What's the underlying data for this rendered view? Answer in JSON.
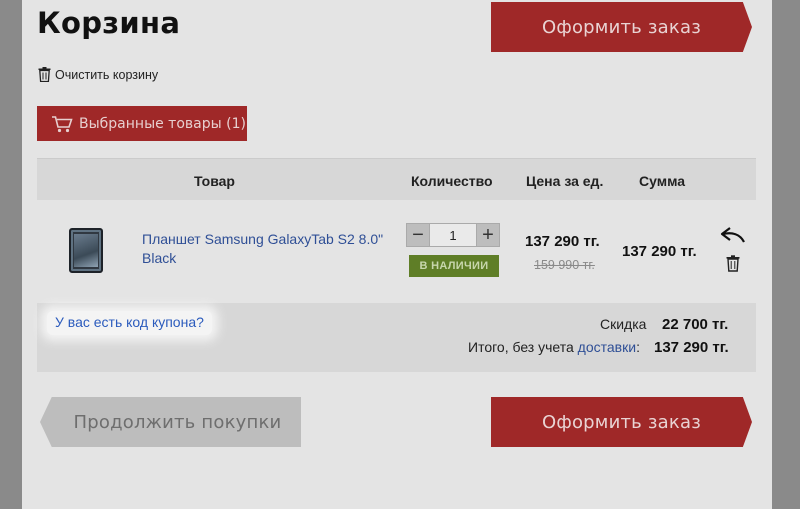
{
  "header": {
    "title": "Корзина",
    "checkout_label": "Оформить заказ",
    "clear_cart_label": "Очистить корзину"
  },
  "favorites": {
    "label": "Выбранные товары (1)"
  },
  "table": {
    "columns": [
      "Товар",
      "Количество",
      "Цена за ед.",
      "Сумма"
    ],
    "items": [
      {
        "name": "Планшет Samsung GalaxyTab S2 8.0\" Black",
        "quantity": "1",
        "stock_status": "В НАЛИЧИИ",
        "price": "137 290 тг.",
        "old_price": "159 990 тг.",
        "sum": "137 290 тг."
      }
    ]
  },
  "summary": {
    "coupon_link": "У вас есть код купона?",
    "discount_label": "Скидка",
    "discount_value": "22 700 тг.",
    "total_label": "Итого, без учета ",
    "delivery_link": "доставки",
    "total_colon": ":",
    "total_value": "137 290 тг."
  },
  "footer": {
    "continue_label": "Продолжить покупки",
    "checkout_label": "Оформить заказ"
  },
  "colors": {
    "accent_red": "#9f2828",
    "stock_green": "#5f7e27",
    "link_blue": "#2f4f96"
  }
}
